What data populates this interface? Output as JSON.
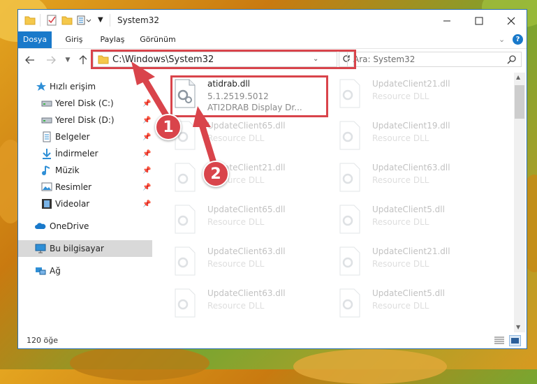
{
  "window": {
    "title": "System32"
  },
  "ribbon": {
    "tabs": [
      "Dosya",
      "Giriş",
      "Paylaş",
      "Görünüm"
    ]
  },
  "address": {
    "path": "C:\\Windows\\System32",
    "search_placeholder": "Ara: System32"
  },
  "sidebar": {
    "items": [
      {
        "label": "Hızlı erişim",
        "icon": "star-icon"
      },
      {
        "label": "Yerel Disk (C:)",
        "icon": "drive-icon",
        "pinned": true
      },
      {
        "label": "Yerel Disk (D:)",
        "icon": "drive-icon",
        "pinned": true
      },
      {
        "label": "Belgeler",
        "icon": "documents-icon",
        "pinned": true
      },
      {
        "label": "İndirmeler",
        "icon": "download-icon",
        "pinned": true
      },
      {
        "label": "Müzik",
        "icon": "music-icon",
        "pinned": true
      },
      {
        "label": "Resimler",
        "icon": "pictures-icon",
        "pinned": true
      },
      {
        "label": "Videolar",
        "icon": "videos-icon",
        "pinned": true
      },
      {
        "label": "OneDrive",
        "icon": "cloud-icon"
      },
      {
        "label": "Bu bilgisayar",
        "icon": "computer-icon",
        "selected": true
      },
      {
        "label": "Ağ",
        "icon": "network-icon"
      }
    ]
  },
  "files": {
    "highlighted": {
      "name": "atidrab.dll",
      "version": "5.1.2519.5012",
      "description": "ATI2DRAB Display Dr..."
    },
    "left_column": [
      {
        "name": "UpdateClient65.dll",
        "type": "Resource DLL"
      },
      {
        "name": "UpdateClient21.dll",
        "type": "Resource DLL"
      },
      {
        "name": "UpdateClient65.dll",
        "type": "Resource DLL"
      },
      {
        "name": "UpdateClient63.dll",
        "type": "Resource DLL"
      },
      {
        "name": "UpdateClient63.dll",
        "type": "Resource DLL"
      }
    ],
    "right_column": [
      {
        "name": "UpdateClient21.dll",
        "type": "Resource DLL"
      },
      {
        "name": "UpdateClient19.dll",
        "type": "Resource DLL"
      },
      {
        "name": "UpdateClient63.dll",
        "type": "Resource DLL"
      },
      {
        "name": "UpdateClient5.dll",
        "type": "Resource DLL"
      },
      {
        "name": "UpdateClient21.dll",
        "type": "Resource DLL"
      },
      {
        "name": "UpdateClient5.dll",
        "type": "Resource DLL"
      }
    ]
  },
  "status": {
    "item_count": "120 öğe"
  },
  "callouts": [
    "1",
    "2"
  ],
  "colors": {
    "accent": "#1979ca",
    "highlight": "#d9444b"
  }
}
